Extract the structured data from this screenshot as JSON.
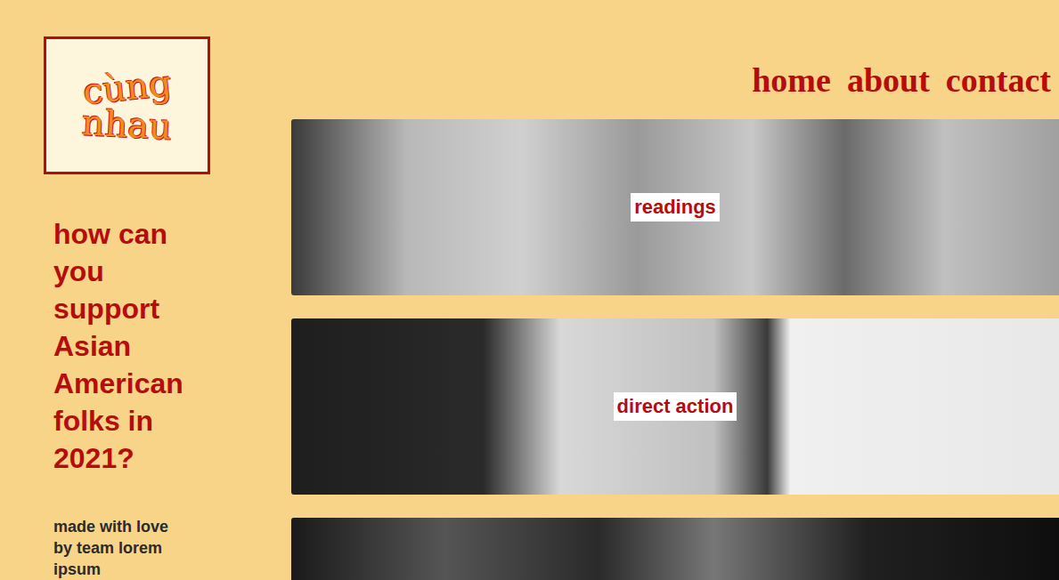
{
  "logo": {
    "line1": "cùng",
    "line2": "nhau"
  },
  "nav": [
    "home",
    "about",
    "contact"
  ],
  "headline": "how can you support Asian American folks in 2021?",
  "credit": "made with love by team lorem ipsum",
  "cards": [
    {
      "label": "readings"
    },
    {
      "label": "direct action"
    }
  ]
}
